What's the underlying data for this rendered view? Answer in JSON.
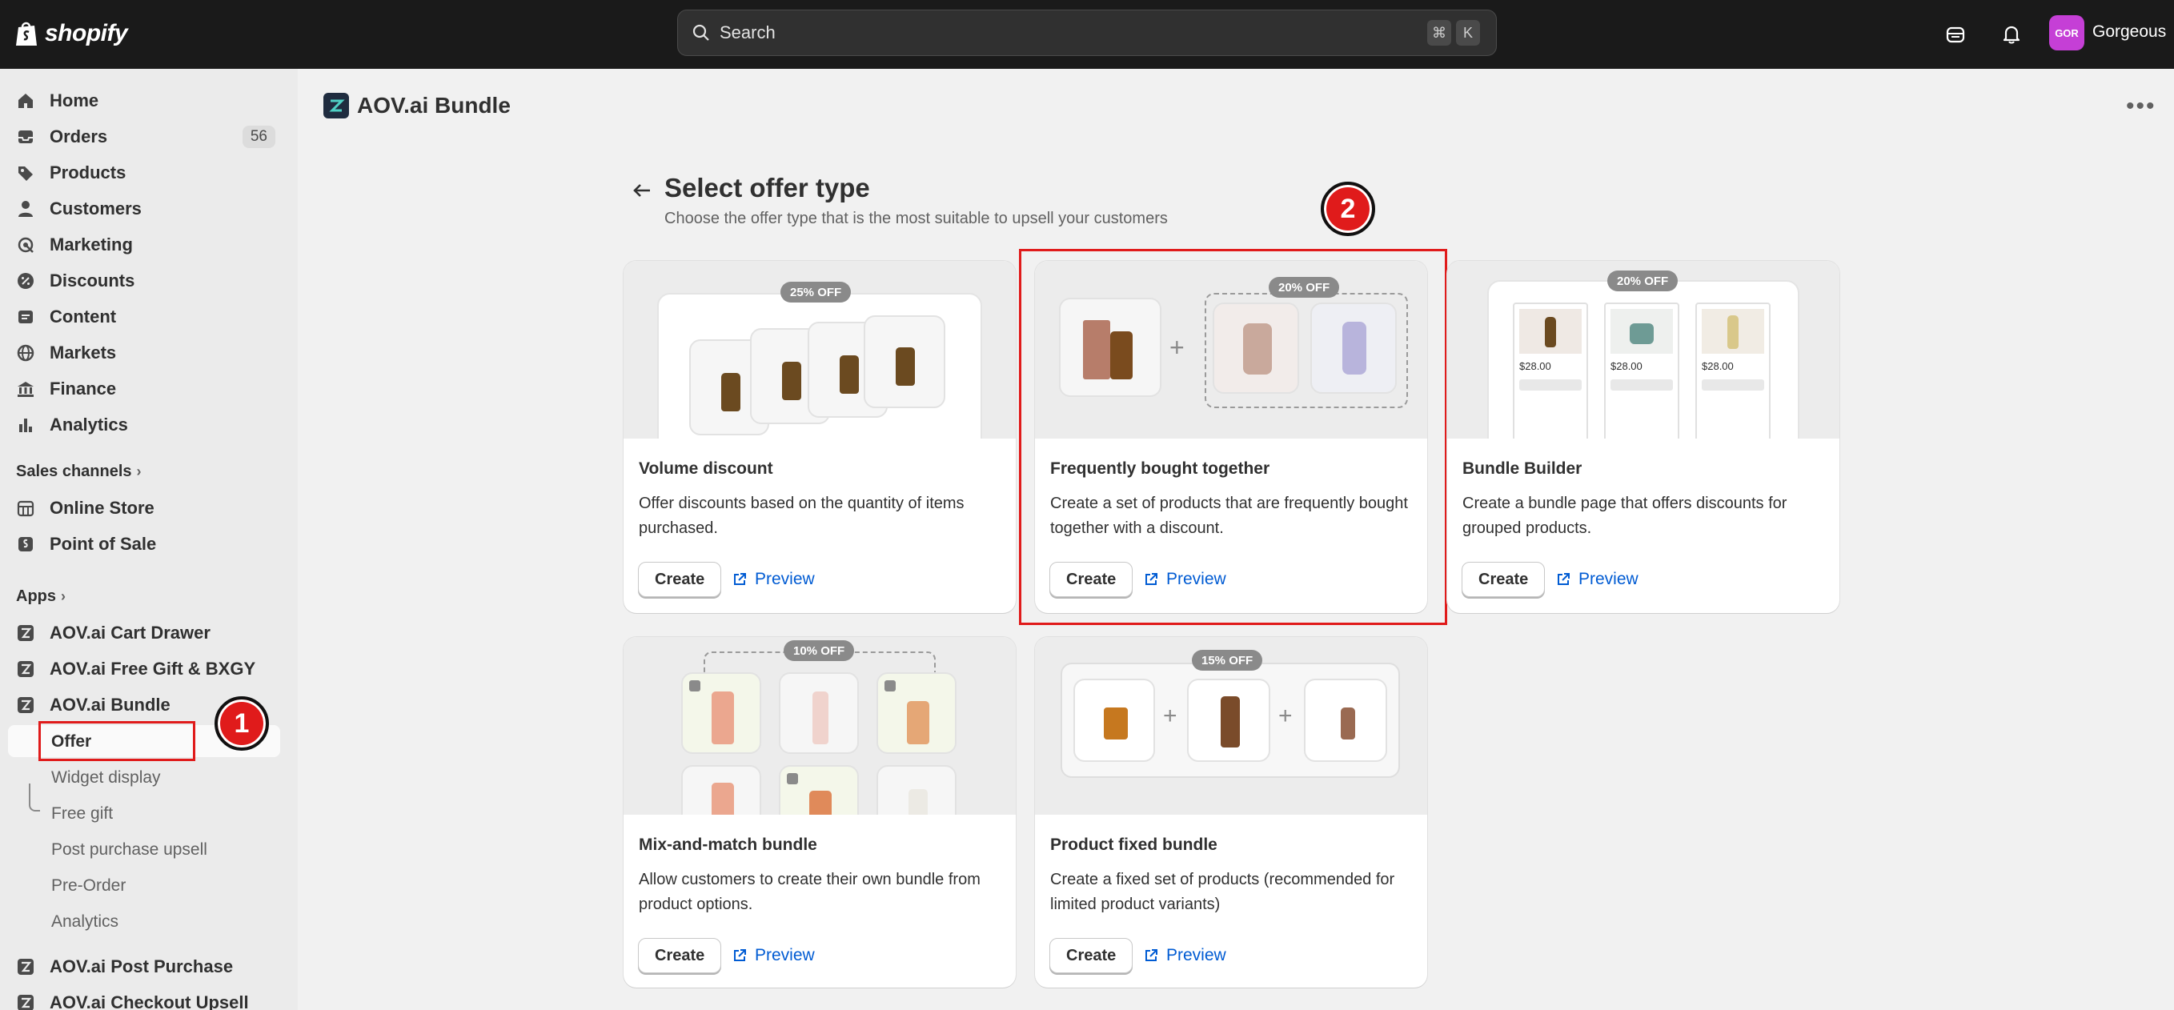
{
  "topbar": {
    "brand": "shopify",
    "search_placeholder": "Search",
    "shortcut_keys": [
      "⌘",
      "K"
    ],
    "avatar_initials": "GOR",
    "avatar_color": "#c53fd6",
    "store_name": "Gorgeous"
  },
  "sidebar": {
    "main": [
      {
        "label": "Home",
        "icon": "home-icon"
      },
      {
        "label": "Orders",
        "icon": "inbox-icon",
        "count": "56"
      },
      {
        "label": "Products",
        "icon": "tag-icon"
      },
      {
        "label": "Customers",
        "icon": "person-icon"
      },
      {
        "label": "Marketing",
        "icon": "target-icon"
      },
      {
        "label": "Discounts",
        "icon": "discount-icon"
      },
      {
        "label": "Content",
        "icon": "content-icon"
      },
      {
        "label": "Markets",
        "icon": "globe-icon"
      },
      {
        "label": "Finance",
        "icon": "bank-icon"
      },
      {
        "label": "Analytics",
        "icon": "bar-chart-icon"
      }
    ],
    "sales_channels_label": "Sales channels",
    "channels": [
      {
        "label": "Online Store",
        "icon": "store-icon"
      },
      {
        "label": "Point of Sale",
        "icon": "pos-icon"
      }
    ],
    "apps_label": "Apps",
    "apps": [
      {
        "label": "AOV.ai Cart Drawer"
      },
      {
        "label": "AOV.ai Free Gift & BXGY"
      },
      {
        "label": "AOV.ai Bundle"
      }
    ],
    "bundle_subitems": [
      "Offer",
      "Widget display",
      "Free gift",
      "Post purchase upsell",
      "Pre-Order",
      "Analytics"
    ],
    "more_apps": [
      {
        "label": "AOV.ai Post Purchase"
      },
      {
        "label": "AOV.ai Checkout Upsell"
      }
    ]
  },
  "app_header": {
    "title": "AOV.ai Bundle"
  },
  "page": {
    "title": "Select offer type",
    "subtitle": "Choose the offer type that is the most suitable to upsell your customers"
  },
  "cards": [
    {
      "title": "Volume discount",
      "desc": "Offer discounts based on the quantity of items purchased.",
      "badge": "25% OFF",
      "create": "Create",
      "preview": "Preview"
    },
    {
      "title": "Frequently bought together",
      "desc": "Create a set of products that are frequently bought together with a discount.",
      "badge": "20% OFF",
      "create": "Create",
      "preview": "Preview"
    },
    {
      "title": "Bundle Builder",
      "desc": "Create a bundle page that offers discounts for grouped products.",
      "badge": "20% OFF",
      "prices": [
        "$28.00",
        "$28.00",
        "$28.00"
      ],
      "create": "Create",
      "preview": "Preview"
    },
    {
      "title": "Mix-and-match bundle",
      "desc": "Allow customers to create their own bundle from product options.",
      "badge": "10% OFF",
      "create": "Create",
      "preview": "Preview"
    },
    {
      "title": "Product fixed bundle",
      "desc": "Create a fixed set of products (recommended for limited product variants)",
      "badge": "15% OFF",
      "create": "Create",
      "preview": "Preview"
    }
  ],
  "annotations": {
    "marker1": "1",
    "marker2": "2",
    "highlight_color": "#e01b1b"
  }
}
